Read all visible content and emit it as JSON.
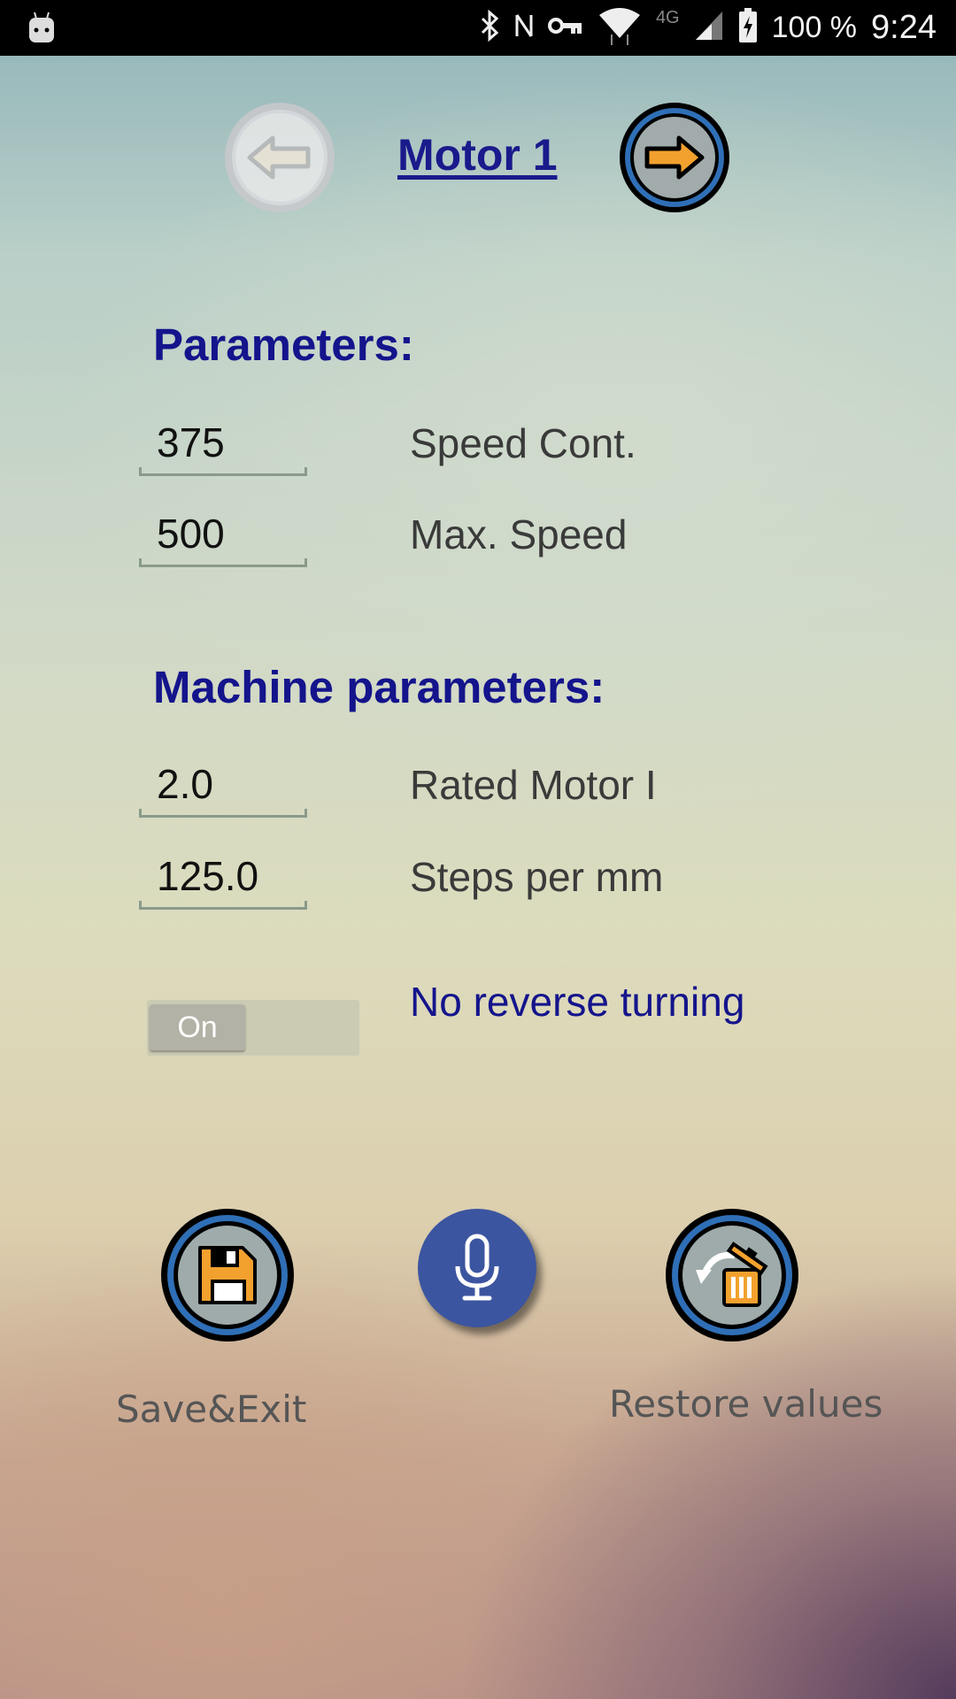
{
  "status_bar": {
    "battery": "100 %",
    "time": "9:24",
    "network": "4G",
    "icons": [
      "android-icon",
      "bluetooth-icon",
      "nfc-icon",
      "vpn-key-icon",
      "wifi-icon",
      "signal-icon",
      "battery-charging-icon"
    ]
  },
  "header": {
    "title": "Motor 1",
    "prev_icon": "arrow-left-icon",
    "next_icon": "arrow-right-icon"
  },
  "parameters": {
    "heading": "Parameters:",
    "fields": [
      {
        "value": "375",
        "label": "Speed Cont."
      },
      {
        "value": "500",
        "label": "Max. Speed"
      }
    ]
  },
  "machine_parameters": {
    "heading": "Machine parameters:",
    "fields": [
      {
        "value": "2.0",
        "label": "Rated Motor I"
      },
      {
        "value": "125.0",
        "label": "Steps per mm"
      }
    ]
  },
  "no_reverse": {
    "toggle_text": "On",
    "label": "No reverse turning"
  },
  "actions": {
    "save_label": "Save&Exit",
    "restore_label": "Restore values",
    "save_icon": "floppy-disk-icon",
    "mic_icon": "microphone-icon",
    "restore_icon": "restore-trash-icon"
  },
  "colors": {
    "heading": "#14148c",
    "accent_orange": "#f2a12e",
    "ring_blue": "#2f6fb7",
    "mic_blue": "#3c55a0"
  }
}
